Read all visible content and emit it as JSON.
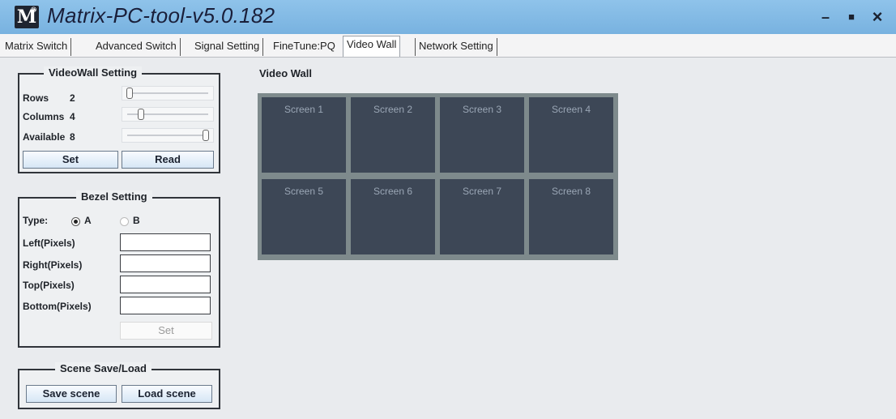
{
  "app": {
    "logo": "M",
    "logo_mark": "®",
    "title": "Matrix-PC-tool-v5.0.182"
  },
  "window_controls": {
    "minimize": "–",
    "maximize": "■",
    "close": "×"
  },
  "tabs": [
    {
      "label": "Matrix Switch"
    },
    {
      "label": "Advanced Switch"
    },
    {
      "label": "Signal Setting"
    },
    {
      "label": "FineTune:PQ"
    },
    {
      "label": "Video Wall",
      "active": true
    },
    {
      "label": "Network Setting"
    }
  ],
  "videowall_setting": {
    "title": "VideoWall Setting",
    "rows_label": "Rows",
    "rows_value": "2",
    "columns_label": "Columns",
    "columns_value": "4",
    "available_label": "Available",
    "available_value": "8",
    "set_label": "Set",
    "read_label": "Read",
    "rows_slider_fraction": 0.05,
    "columns_slider_fraction": 0.18,
    "available_slider_fraction": 0.95
  },
  "bezel_setting": {
    "title": "Bezel Setting",
    "type_label": "Type:",
    "option_a": "A",
    "option_b": "B",
    "selected": "A",
    "left_label": "Left(Pixels)",
    "left_value": "",
    "right_label": "Right(Pixels)",
    "right_value": "",
    "top_label": "Top(Pixels)",
    "top_value": "",
    "bottom_label": "Bottom(Pixels)",
    "bottom_value": "",
    "set_label": "Set"
  },
  "scene": {
    "title": "Scene Save/Load",
    "save_label": "Save scene",
    "load_label": "Load scene"
  },
  "video_wall": {
    "title": "Video Wall",
    "screens": [
      "Screen 1",
      "Screen 2",
      "Screen 3",
      "Screen 4",
      "Screen 5",
      "Screen 6",
      "Screen 7",
      "Screen 8"
    ]
  },
  "colors": {
    "titlebar": "#86bde7",
    "screen_bg": "#3d4756",
    "wall_border": "#7e8a8c"
  }
}
